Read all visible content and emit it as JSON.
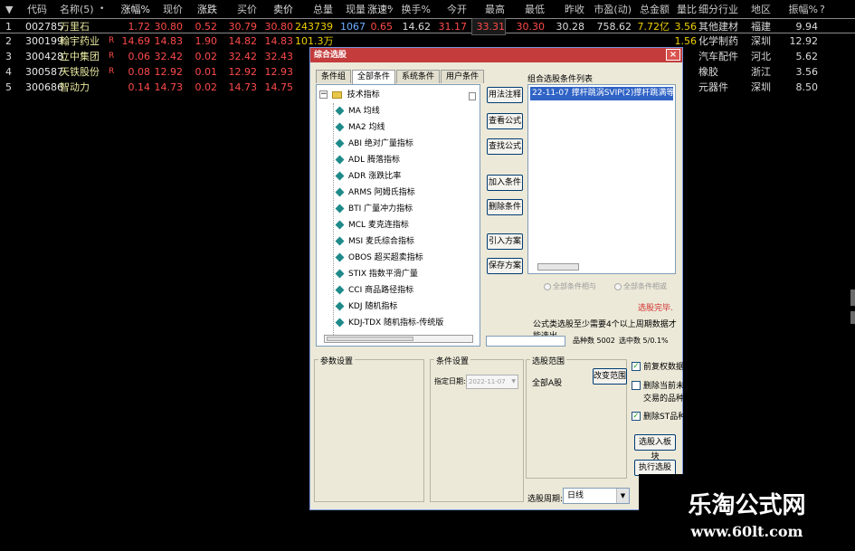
{
  "columns": {
    "sort_marker": "▼",
    "code": "代码",
    "name": "名称(5)",
    "dot": "•",
    "chg": "涨幅%",
    "price": "现价",
    "diff": "涨跌",
    "bid": "买价",
    "ask": "卖价",
    "vol": "总量",
    "cur": "现量",
    "speed": "涨速%",
    "turnover": "换手%",
    "open": "今开",
    "high": "最高",
    "low": "最低",
    "prev": "昨收",
    "pe": "市盈(动)",
    "amount": "总金额",
    "ratio": "量比",
    "industry": "细分行业",
    "region": "地区",
    "amp": "振幅%",
    "more": "?"
  },
  "rows": [
    {
      "idx": "1",
      "code": "002785",
      "name": "万里石",
      "flag": "",
      "chg": "1.72",
      "price": "30.80",
      "diff": "0.52",
      "bid": "30.79",
      "ask": "30.80",
      "vol": "243739",
      "cur": "1067",
      "speed": "0.65",
      "turnover": "14.62",
      "open": "31.17",
      "high": "33.31",
      "low": "30.30",
      "prev": "30.28",
      "pe": "758.62",
      "amount": "7.72亿",
      "ratio": "3.56",
      "industry": "其他建材",
      "region": "福建",
      "amp": "9.94"
    },
    {
      "idx": "2",
      "code": "300199",
      "name": "翰宇药业",
      "flag": "R",
      "chg": "14.69",
      "price": "14.83",
      "diff": "1.90",
      "bid": "14.82",
      "ask": "14.83",
      "vol": "101.3万",
      "cur": "",
      "speed": "",
      "turnover": "",
      "open": "",
      "high": "",
      "low": "",
      "prev": "",
      "pe": "",
      "amount": "",
      "ratio": "1.56",
      "industry": "化学制药",
      "region": "深圳",
      "amp": "12.92"
    },
    {
      "idx": "3",
      "code": "300428",
      "name": "立中集团",
      "flag": "R",
      "chg": "0.06",
      "price": "32.42",
      "diff": "0.02",
      "bid": "32.42",
      "ask": "32.43",
      "vol": "14",
      "cur": "",
      "speed": "",
      "turnover": "",
      "open": "",
      "high": "",
      "low": "",
      "prev": "",
      "pe": "",
      "amount": "",
      "ratio": "",
      "industry": "汽车配件",
      "region": "河北",
      "amp": "5.62"
    },
    {
      "idx": "4",
      "code": "300587",
      "name": "天铁股份",
      "flag": "R",
      "chg": "0.08",
      "price": "12.92",
      "diff": "0.01",
      "bid": "12.92",
      "ask": "12.93",
      "vol": "42",
      "cur": "",
      "speed": "",
      "turnover": "",
      "open": "",
      "high": "",
      "low": "",
      "prev": "",
      "pe": "",
      "amount": "",
      "ratio": "",
      "industry": "橡胶",
      "region": "浙江",
      "amp": "3.56"
    },
    {
      "idx": "5",
      "code": "300686",
      "name": "智动力",
      "flag": "",
      "chg": "0.14",
      "price": "14.73",
      "diff": "0.02",
      "bid": "14.73",
      "ask": "14.75",
      "vol": "16",
      "cur": "",
      "speed": "",
      "turnover": "",
      "open": "",
      "high": "",
      "low": "",
      "prev": "",
      "pe": "",
      "amount": "",
      "ratio": "",
      "industry": "元器件",
      "region": "深圳",
      "amp": "8.50"
    }
  ],
  "dialog": {
    "title": "综合选股",
    "close": "×",
    "tabs": [
      "条件组",
      "全部条件",
      "系统条件",
      "用户条件"
    ],
    "tree_root": "技术指标",
    "tree_items": [
      "MA 均线",
      "MA2 均线",
      "ABI 绝对广量指标",
      "ADL 腾落指标",
      "ADR 涨跌比率",
      "ARMS 阿姆氏指标",
      "BTI 广量冲力指标",
      "MCL 麦克连指标",
      "MSI 麦氏综合指标",
      "OBOS 超买超卖指标",
      "STIX 指数平滑广量",
      "CCI 商品路径指标",
      "KDJ 随机指标",
      "KDJ-TDX 随机指标-传统版"
    ],
    "buttons": {
      "usage": "用法注释",
      "view_formula": "查看公式",
      "find_formula": "查找公式",
      "add_cond": "加入条件",
      "del_cond": "删除条件",
      "import_plan": "引入方案",
      "save_plan": "保存方案",
      "change_range": "改变范围",
      "add_to_block": "选股入板块",
      "run": "执行选股"
    },
    "cond_list_label": "组合选股条件列表",
    "cond_selected": "22-11-07 撑杆跳涡SVIP(2)撑杆跳满等于1",
    "radio_and": "全部条件相与",
    "radio_or": "全部条件相或",
    "warn": "选股完毕.",
    "note": "公式类选股至少需要4个以上周期数据才能选出",
    "count": "品种数 5002",
    "hit": "选中数 5/0.1%",
    "param_group": "参数设置",
    "cond_group": "条件设置",
    "date_label": "指定日期:",
    "date_value": "2022-11-07",
    "range_group": "选股范围",
    "range_value": "全部A股",
    "chk_rights": "前复权数据",
    "chk_unlisted_1": "删除当前未",
    "chk_unlisted_2": "交易的品种",
    "chk_st": "删除ST品种",
    "period_label": "选股周期:",
    "period_value": "日线"
  },
  "watermark": {
    "title": "乐淘公式网",
    "url": "www.60lt.com"
  }
}
